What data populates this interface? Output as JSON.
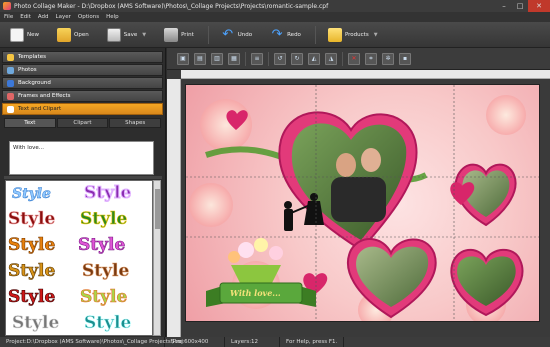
{
  "window": {
    "title": "Photo Collage Maker - D:\\Dropbox (AMS Software)\\Photos\\_Collage Projects\\Projects\\romantic-sample.cpf"
  },
  "menu": [
    "File",
    "Edit",
    "Add",
    "Layer",
    "Options",
    "Help"
  ],
  "toolbar": {
    "new": "New",
    "open": "Open",
    "save": "Save",
    "print": "Print",
    "undo": "Undo",
    "redo": "Redo",
    "products": "Products"
  },
  "left_panel": {
    "sections": [
      "Templates",
      "Photos",
      "Background",
      "Frames and Effects",
      "Text and Clipart"
    ],
    "active_section": "Text and Clipart",
    "tabs": [
      "Text",
      "Clipart",
      "Shapes"
    ],
    "text_value": "With love...",
    "style_sample": "Style"
  },
  "canvas": {
    "banner_text": "With love..."
  },
  "colors": {
    "accent": "#f5a623",
    "page_bg": "#f8c9c9",
    "heart": "#e23a7a",
    "ribbon": "#5aa83c"
  },
  "status": {
    "project": "Project:D:\\Dropbox (AMS Software)\\Photos\\_Collage Projects\\Proj",
    "size": "Size:600x400",
    "layers": "Layers:12",
    "help": "For Help, press F1."
  }
}
